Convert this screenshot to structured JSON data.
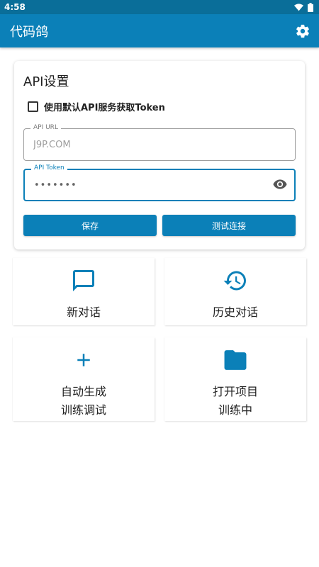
{
  "status_bar": {
    "time": "4:58",
    "icons": [
      "wifi-icon",
      "battery-icon"
    ]
  },
  "app_bar": {
    "title": "代码鸽",
    "settings_icon": "gear-icon"
  },
  "api_settings": {
    "title": "API设置",
    "use_default_checkbox": {
      "label": "使用默认API服务获取Token",
      "checked": false
    },
    "api_url": {
      "label": "API URL",
      "value": "J9P.COM"
    },
    "api_token": {
      "label": "API Token",
      "value": "•••••••"
    },
    "save_label": "保存",
    "test_label": "测试连接"
  },
  "tiles": [
    {
      "icon": "chat-bubble-icon",
      "lines": [
        "新对话"
      ]
    },
    {
      "icon": "history-icon",
      "lines": [
        "历史对话"
      ]
    },
    {
      "icon": "plus-icon",
      "lines": [
        "自动生成",
        "训练调试"
      ]
    },
    {
      "icon": "folder-icon",
      "lines": [
        "打开项目",
        "训练中"
      ]
    }
  ],
  "colors": {
    "status_bar": "#0a6e99",
    "primary": "#0b80b8"
  }
}
